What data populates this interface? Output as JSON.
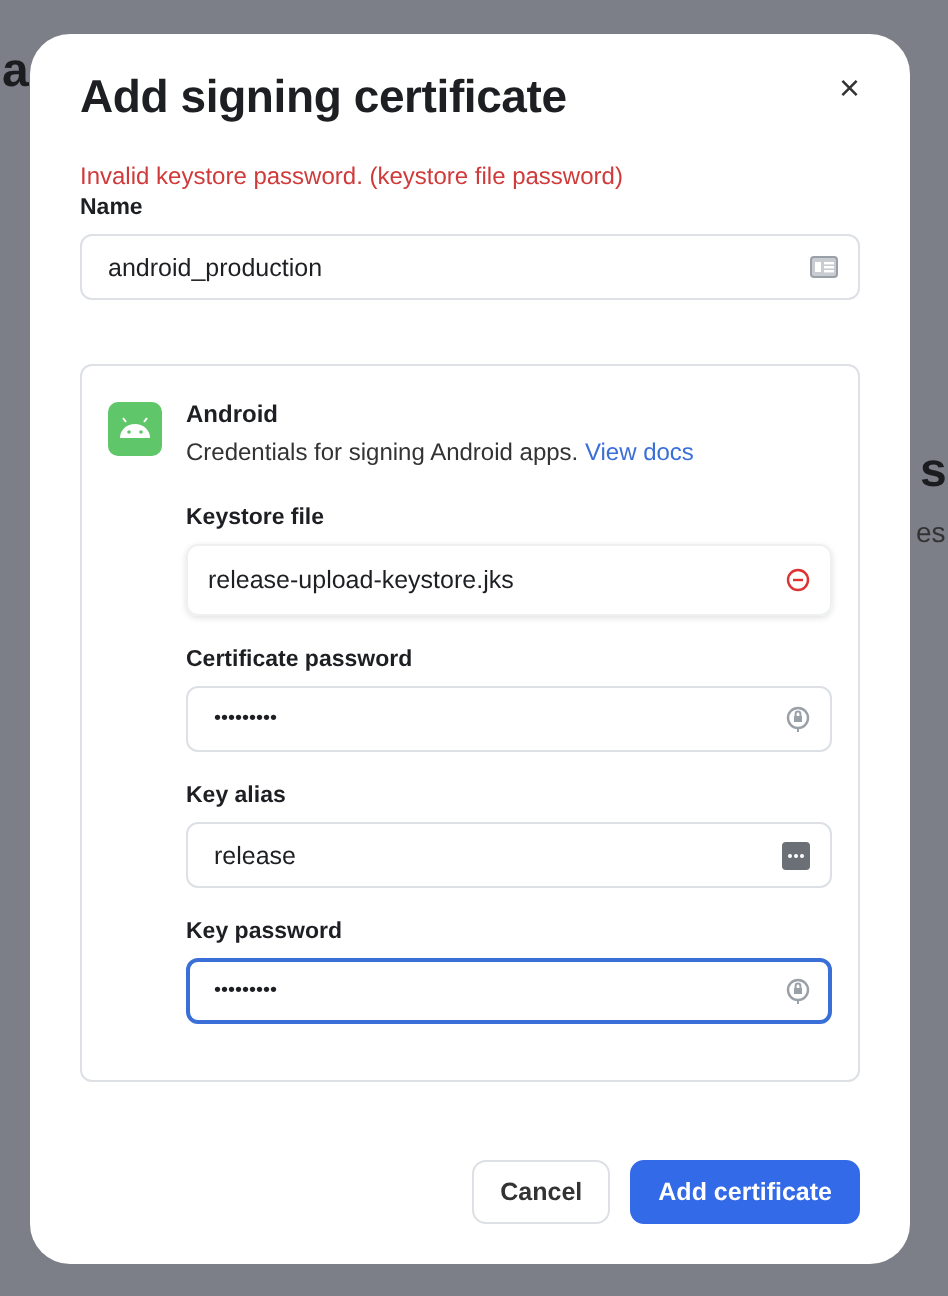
{
  "background": {
    "fragments": [
      {
        "text": "a",
        "kind": "heading"
      },
      {
        "text": "s",
        "kind": "heading"
      },
      {
        "text": "es",
        "kind": "body"
      }
    ]
  },
  "dialog": {
    "title": "Add signing certificate",
    "close": "×",
    "error": "Invalid keystore password. (keystore file password)",
    "name_field": {
      "label": "Name",
      "value": "android_production",
      "focused": false
    },
    "platform": {
      "title": "Android",
      "description": "Credentials for signing Android apps.",
      "link": "View docs"
    },
    "fields": [
      {
        "kind": "file",
        "label": "Keystore file",
        "value": "release-upload-keystore.jks",
        "focused": false
      },
      {
        "kind": "secret",
        "label": "Certificate password",
        "value": "•••••••••",
        "focused": false
      },
      {
        "kind": "alias",
        "label": "Key alias",
        "value": "release",
        "focused": false
      },
      {
        "kind": "secret",
        "label": "Key password",
        "value": "•••••••••",
        "focused": true
      }
    ],
    "buttons": [
      {
        "kind": "secondary",
        "label": "Cancel"
      },
      {
        "kind": "primary",
        "label": "Add certificate"
      }
    ]
  }
}
